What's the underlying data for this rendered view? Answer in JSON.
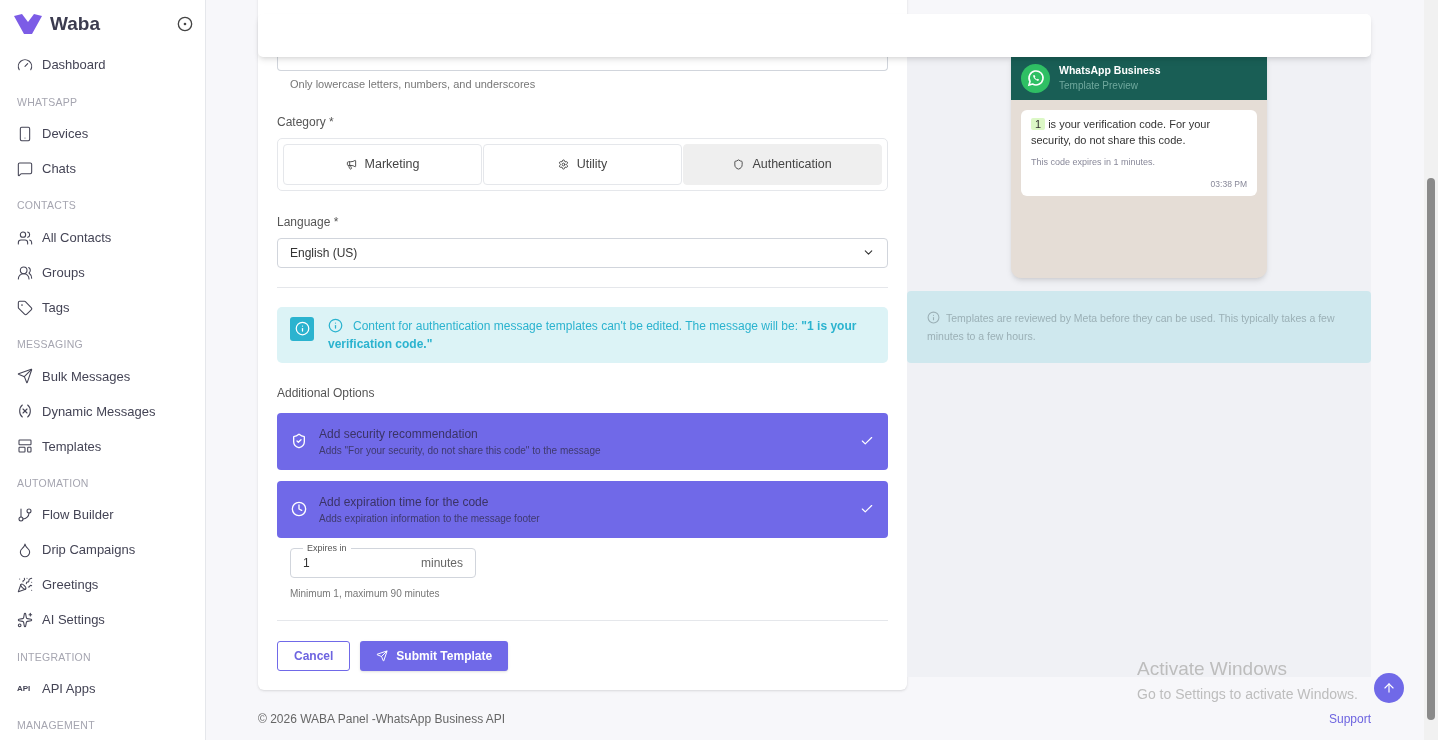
{
  "brand": {
    "name": "Waba"
  },
  "sidebar": {
    "sections": [
      {
        "items": [
          {
            "label": "Dashboard",
            "selected": false
          }
        ]
      },
      {
        "heading": "WHATSAPP",
        "items": [
          {
            "label": "Devices",
            "selected": false
          },
          {
            "label": "Chats",
            "selected": false
          }
        ]
      },
      {
        "heading": "CONTACTS",
        "items": [
          {
            "label": "All Contacts",
            "selected": false
          },
          {
            "label": "Groups",
            "selected": false
          },
          {
            "label": "Tags",
            "selected": false
          }
        ]
      },
      {
        "heading": "MESSAGING",
        "items": [
          {
            "label": "Bulk Messages",
            "selected": false
          },
          {
            "label": "Dynamic Messages",
            "selected": false
          },
          {
            "label": "Templates",
            "selected": false
          }
        ]
      },
      {
        "heading": "AUTOMATION",
        "items": [
          {
            "label": "Flow Builder",
            "selected": false
          },
          {
            "label": "Drip Campaigns",
            "selected": false
          },
          {
            "label": "Greetings",
            "selected": false
          },
          {
            "label": "AI Settings",
            "selected": false
          }
        ]
      },
      {
        "heading": "INTEGRATION",
        "items": [
          {
            "label": "API Apps",
            "icon_text": "API",
            "selected": false
          }
        ]
      },
      {
        "heading": "MANAGEMENT"
      }
    ]
  },
  "form": {
    "name_hint": "Only lowercase letters, numbers, and underscores",
    "category": {
      "label": "Category *",
      "options": [
        {
          "label": "Marketing",
          "selected": false
        },
        {
          "label": "Utility",
          "selected": false
        },
        {
          "label": "Authentication",
          "selected": true
        }
      ]
    },
    "language": {
      "label": "Language *",
      "value": "English (US)"
    },
    "alert": "Content for authentication message templates can't be edited. The message will be: **\"1 is your verification code.\"**",
    "additional_label": "Additional Options",
    "options": [
      {
        "title": "Add security recommendation",
        "description": "Adds \"For your security, do not share this code\" to the message",
        "checked": true
      },
      {
        "title": "Add expiration time for the code",
        "description": "Adds expiration information to the message footer",
        "checked": true
      }
    ],
    "expires": {
      "label": "Expires in",
      "value": "1",
      "unit": "minutes",
      "hint": "Minimum 1, maximum 90 minutes"
    },
    "buttons": {
      "cancel": "Cancel",
      "submit": "Submit Template"
    }
  },
  "preview": {
    "title": "WhatsApp Business",
    "subtitle": "Template Preview",
    "code": "1",
    "message": "is your verification code. For your security, do not share this code.",
    "footer": "This code expires in 1 minutes.",
    "time": "03:38 PM"
  },
  "review_note": "Templates are reviewed by Meta before they can be used. This typically takes a few minutes to a few hours.",
  "footer": {
    "copyright": "© 2026 WABA Panel -WhatsApp Business API",
    "link": "Support"
  },
  "os_notice": {
    "title": "Activate Windows",
    "subtitle": "Go to Settings to activate Windows."
  }
}
